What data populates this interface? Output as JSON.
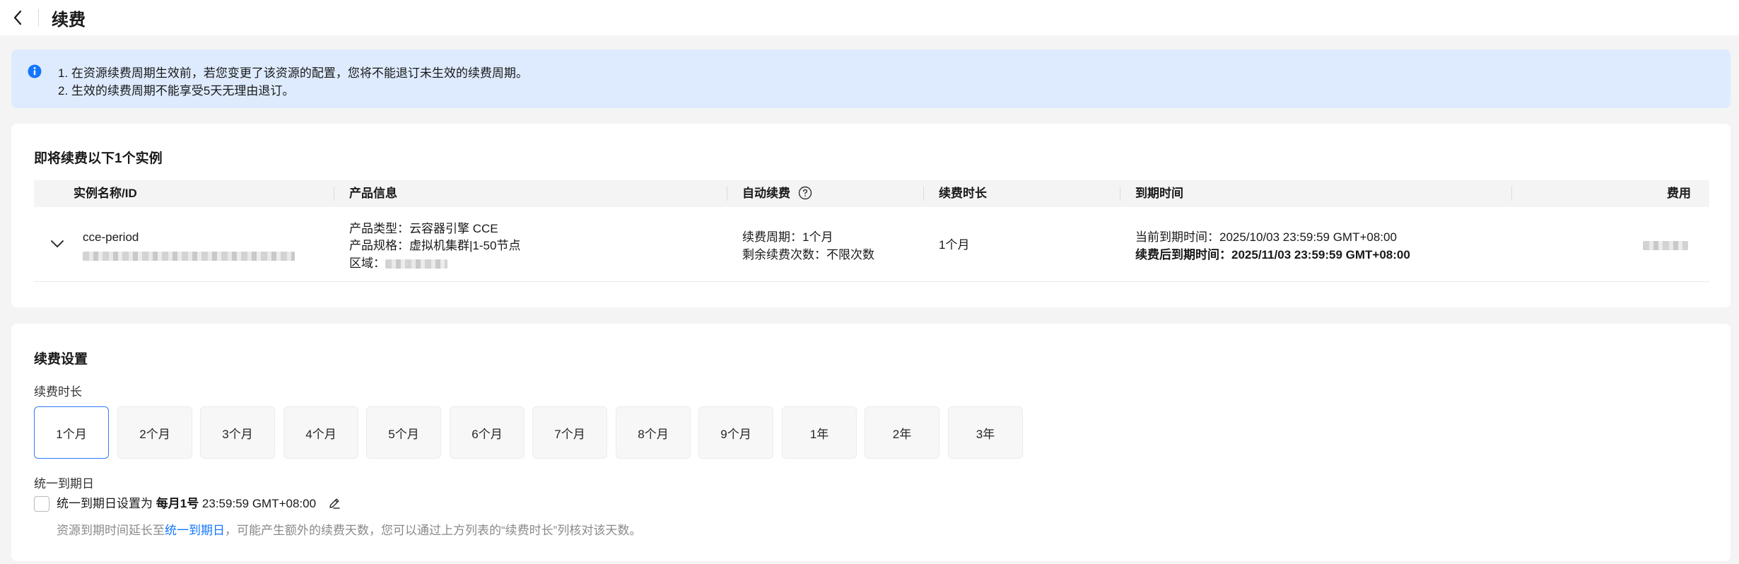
{
  "header": {
    "title": "续费"
  },
  "notice": {
    "line1": "1. 在资源续费周期生效前，若您变更了该资源的配置，您将不能退订未生效的续费周期。",
    "line2": "2. 生效的续费周期不能享受5天无理由退订。"
  },
  "instances": {
    "title": "即将续费以下1个实例",
    "columns": {
      "name": "实例名称/ID",
      "product": "产品信息",
      "auto_renew": "自动续费",
      "duration": "续费时长",
      "expiry": "到期时间",
      "fee": "费用"
    },
    "rows": [
      {
        "name": "cce-period",
        "product_type": "产品类型：云容器引擎 CCE",
        "product_spec": "产品规格：虚拟机集群|1-50节点",
        "region_label": "区域：",
        "renew_cycle": "续费周期：1个月",
        "remaining": "剩余续费次数：不限次数",
        "duration": "1个月",
        "current_expiry": "当前到期时间：2025/10/03 23:59:59 GMT+08:00",
        "new_expiry": "续费后到期时间：2025/11/03 23:59:59 GMT+08:00"
      }
    ]
  },
  "settings": {
    "title": "续费设置",
    "duration_label": "续费时长",
    "options": [
      "1个月",
      "2个月",
      "3个月",
      "4个月",
      "5个月",
      "6个月",
      "7个月",
      "8个月",
      "9个月",
      "1年",
      "2年",
      "3年"
    ],
    "selected_option": "1个月",
    "unify_label": "统一到期日",
    "unify_prefix": "统一到期日设置为 ",
    "unify_day": "每月1号",
    "unify_time": " 23:59:59 GMT+08:00",
    "hint_prefix": "资源到期时间延长至",
    "hint_link": "统一到期日",
    "hint_suffix": "，可能产生额外的续费天数，您可以通过上方列表的“续费时长”列核对该天数。"
  },
  "colors": {
    "accent": "#2e7cf6",
    "link": "#1476ff",
    "notice_bg": "#deebff",
    "page_bg": "#f4f4f5"
  },
  "icons": [
    "back-arrow-icon",
    "info-icon",
    "help-icon",
    "chevron-down-icon",
    "edit-icon"
  ]
}
